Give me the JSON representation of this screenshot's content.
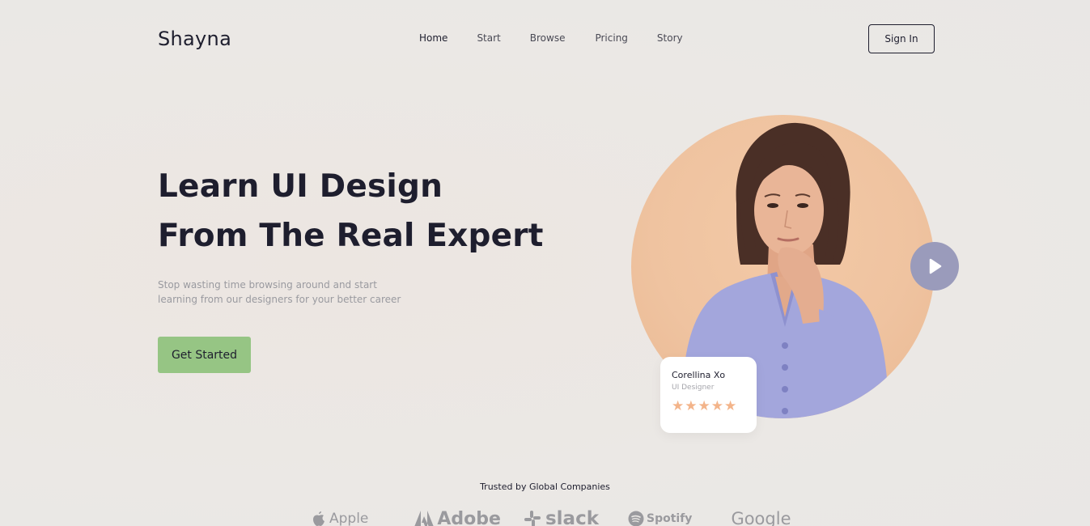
{
  "header": {
    "logo": "Shayna",
    "nav": [
      "Home",
      "Start",
      "Browse",
      "Pricing",
      "Story"
    ],
    "active_nav": "Home",
    "signin_label": "Sign In"
  },
  "hero": {
    "title_line1": "Learn UI Design",
    "title_line2": "From The Real Expert",
    "subtitle_line1": "Stop wasting time browsing around and start",
    "subtitle_line2": "learning from our designers for your better career",
    "cta_label": "Get Started"
  },
  "profile": {
    "name": "Corellina Xo",
    "role": "UI Designer",
    "rating": 5
  },
  "trusted": {
    "heading": "Trusted by Global Companies",
    "companies": [
      "Apple",
      "Adobe",
      "slack",
      "Spotify",
      "Google"
    ]
  },
  "colors": {
    "accent_green": "#96c584",
    "portrait_bg": "#efc3a0",
    "play_button": "#9a9bbb",
    "star": "#f3b48a"
  },
  "icons": {
    "play": "play-icon",
    "star": "star-icon",
    "apple": "apple-logo-icon",
    "adobe": "adobe-logo-icon",
    "slack": "slack-logo-icon",
    "spotify": "spotify-logo-icon"
  }
}
